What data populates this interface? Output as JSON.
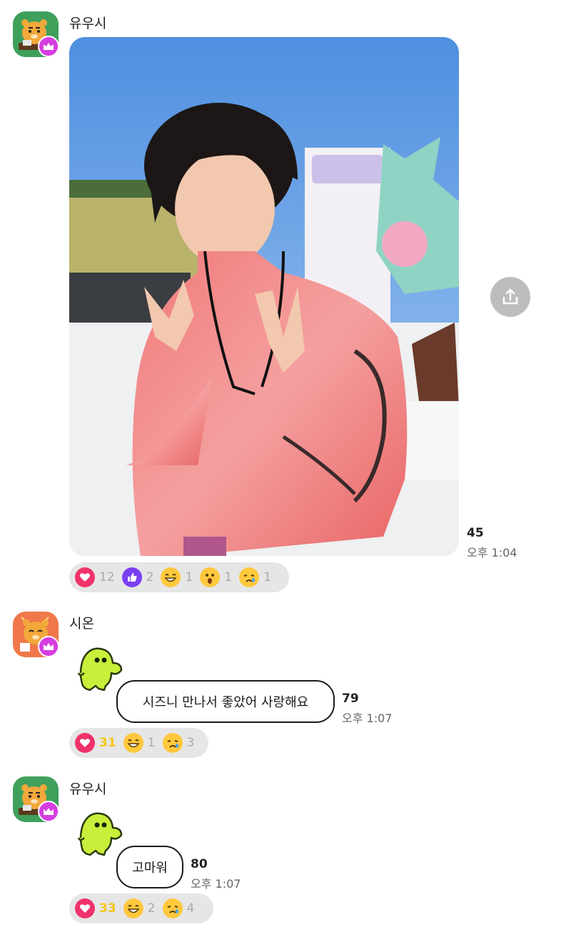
{
  "messages": [
    {
      "sender": "유우시",
      "type": "photo",
      "read_count": "45",
      "time": "오후 1:04",
      "reactions": [
        {
          "icon": "heart-icon",
          "count": "12"
        },
        {
          "icon": "thumbs-up-icon",
          "count": "2"
        },
        {
          "icon": "grin-emoji-icon",
          "count": "1"
        },
        {
          "icon": "surprised-emoji-icon",
          "count": "1"
        },
        {
          "icon": "crying-emoji-icon",
          "count": "1"
        }
      ]
    },
    {
      "sender": "시온",
      "type": "sticker_text",
      "text": "시즈니 만나서 좋았어 사랑해요",
      "read_count": "79",
      "time": "오후 1:07",
      "reactions": [
        {
          "icon": "heart-icon",
          "count": "31"
        },
        {
          "icon": "grin-emoji-icon",
          "count": "1"
        },
        {
          "icon": "crying-emoji-icon",
          "count": "3"
        }
      ]
    },
    {
      "sender": "유우시",
      "type": "sticker_text",
      "text": "고마워",
      "read_count": "80",
      "time": "오후 1:07",
      "reactions": [
        {
          "icon": "heart-icon",
          "count": "33"
        },
        {
          "icon": "grin-emoji-icon",
          "count": "2"
        },
        {
          "icon": "crying-emoji-icon",
          "count": "4"
        }
      ]
    }
  ],
  "colors": {
    "crown_badge": "#d63de0",
    "heart": "#f0326a",
    "thumbs_up": "#7a3ff2",
    "highlight_count": "#f5c518",
    "reaction_bar": "#e6e6e6",
    "share_button": "#bdbdbd"
  }
}
